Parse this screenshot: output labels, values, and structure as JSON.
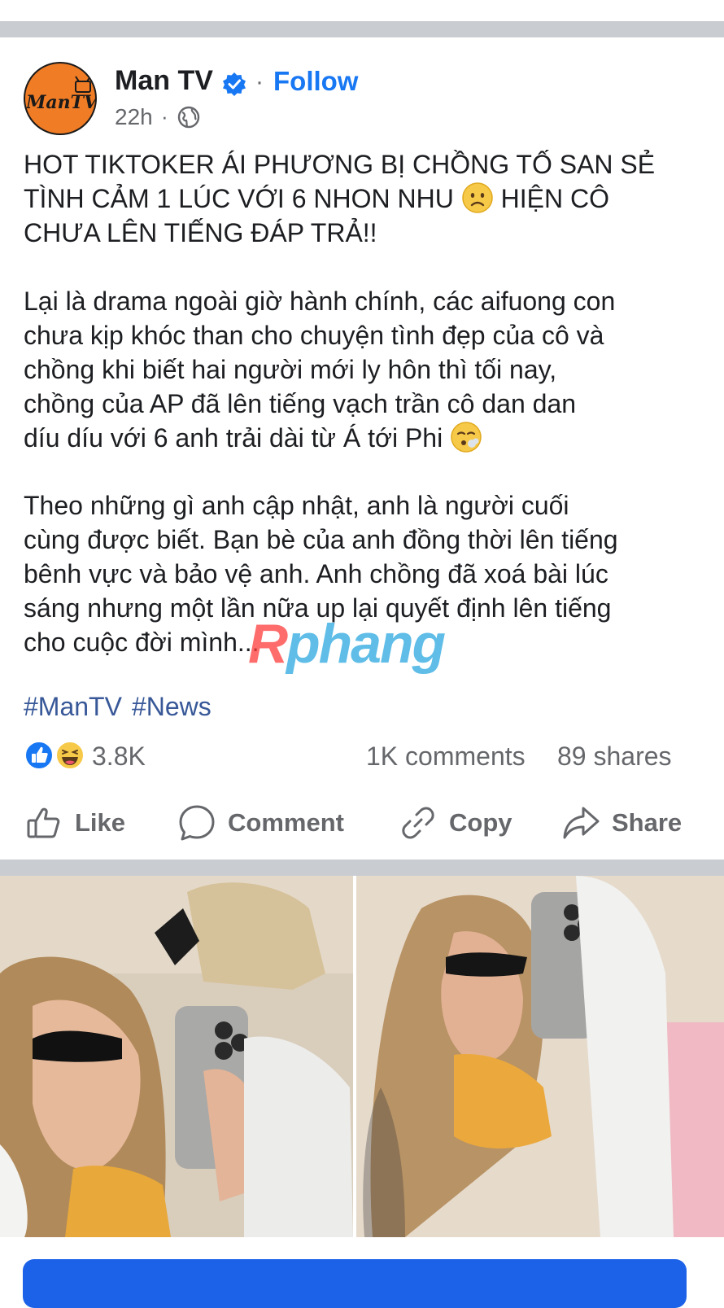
{
  "post": {
    "page_name": "Man TV",
    "follow_label": "Follow",
    "timestamp": "22h",
    "separator": "·",
    "avatar_text": "ManTV",
    "headline": "HOT TIKTOKER ÁI PHƯƠNG BỊ CHỒNG TỐ SAN SẺ\nTÌNH CẢM 1 LÚC VỚI 6 NHON NHU",
    "headline_tail": " HIỆN CÔ\nCHƯA LÊN TIẾNG ĐÁP TRẢ!!",
    "paragraph1": "Lại là drama ngoài giờ hành chính, các aifuong con\nchưa kịp khóc than cho chuyện tình đẹp của cô và\nchồng khi biết hai người mới ly hôn thì tối nay,\nchồng của AP đã lên tiếng vạch trần cô dan dan\ndíu díu với 6 anh trải dài từ Á tới Phi",
    "paragraph2": "Theo những gì anh cập nhật, anh là người cuối\ncùng được biết. Bạn bè của anh đồng thời lên tiếng\nbênh vực và bảo vệ anh. Anh chồng đã xoá bài lúc\nsáng nhưng một lần nữa up lại quyết định lên tiếng\ncho cuộc đời mình...",
    "hashtags": [
      "#ManTV",
      "#News"
    ],
    "watermark_r": "R",
    "watermark_rest": "phang"
  },
  "stats": {
    "reactions_count": "3.8K",
    "comments": "1K comments",
    "shares": "89 shares"
  },
  "actions": {
    "like": "Like",
    "comment": "Comment",
    "copy": "Copy",
    "share": "Share"
  },
  "colors": {
    "accent": "#1877f2",
    "separator": "#c9ccd1",
    "avatar_bg": "#f07c25",
    "hashtag": "#385898",
    "secondary_text": "#65676b"
  },
  "icons": {
    "verified": "verified-badge-icon",
    "globe": "globe-icon",
    "like": "thumbs-up-icon",
    "comment": "speech-bubble-icon",
    "copy": "link-icon",
    "share": "share-arrow-icon",
    "headline_emoji": "frowning-face-emoji",
    "paragraph_emoji": "exhaling-face-emoji"
  }
}
